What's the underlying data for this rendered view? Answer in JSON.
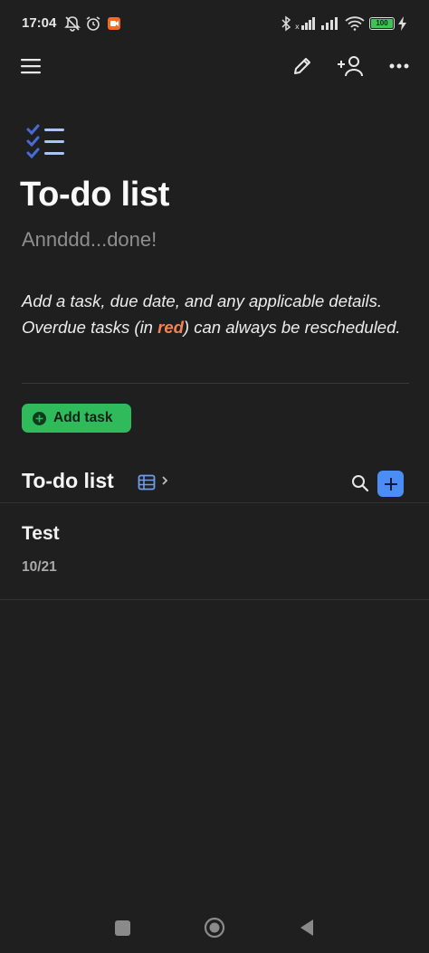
{
  "status_bar": {
    "time": "17:04",
    "battery": "100",
    "icons": [
      "mute-notifications-icon",
      "alarm-icon",
      "app-notification-icon",
      "bluetooth-icon",
      "signal-icon",
      "wifi-icon",
      "battery-icon",
      "charging-icon"
    ]
  },
  "toolbar": {
    "icons": [
      "menu-icon",
      "edit-icon",
      "add-person-icon",
      "more-icon"
    ]
  },
  "page": {
    "icon": "checklist-icon",
    "title": "To-do list",
    "subtitle": "Annddd...done!",
    "description_part1": "Add a task, due date, and any applicable details. Overdue tasks (in ",
    "description_red": "red",
    "description_part2": ") can always be rescheduled.",
    "red_color": "#f5834f"
  },
  "add_task": {
    "label": "Add task",
    "color": "#2fba5c"
  },
  "database": {
    "title": "To-do list",
    "view_icon": "table-icon",
    "add_color": "#4b8df5"
  },
  "items": [
    {
      "title": "Test",
      "date": "10/21"
    }
  ],
  "nav_bar": {
    "icons": [
      "recents-icon",
      "home-icon",
      "back-icon"
    ]
  }
}
